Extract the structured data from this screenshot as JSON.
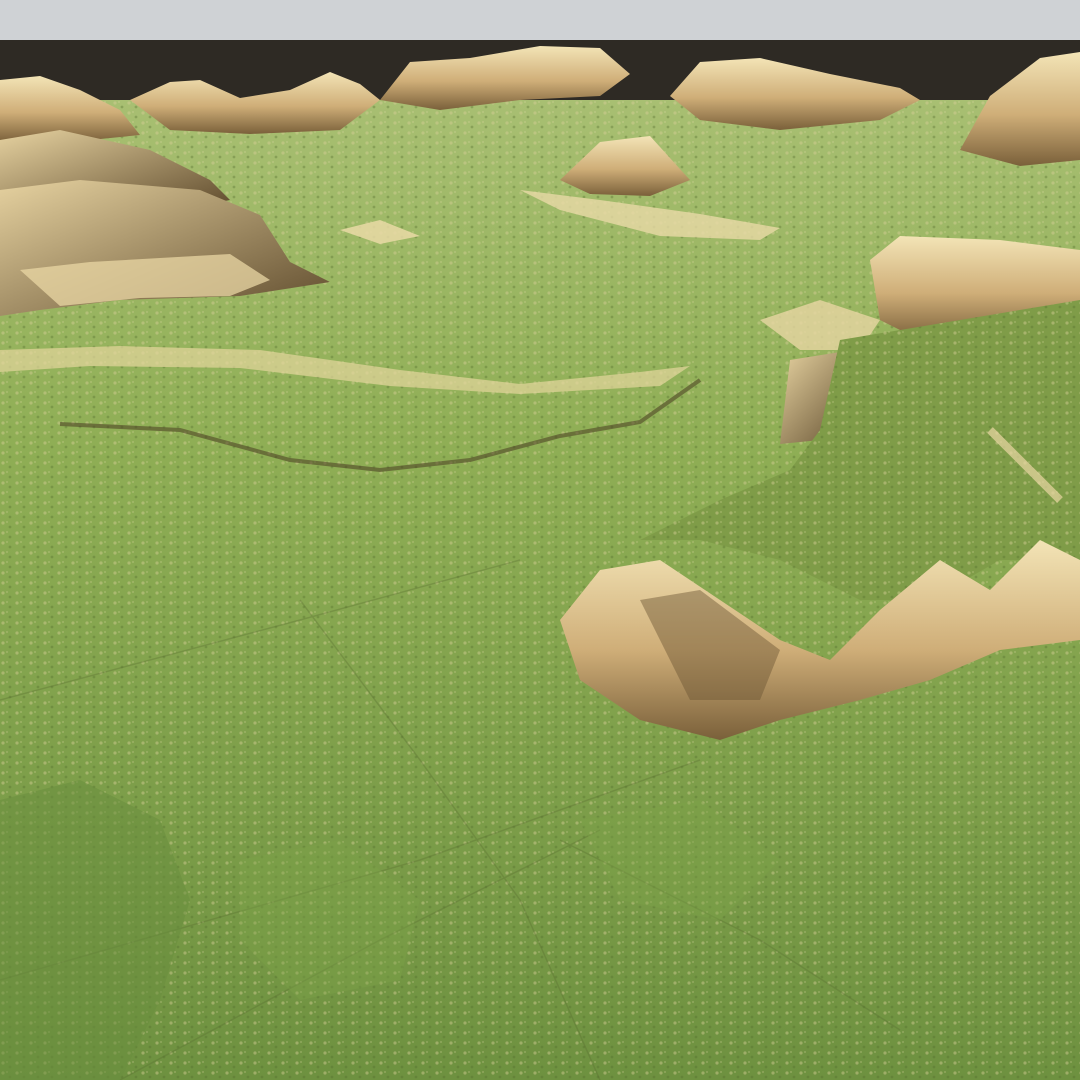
{
  "scene": {
    "kind": "3d-terrain-render",
    "colors": {
      "sky": "#cfd2d5",
      "horizon_band": "#2e2a24",
      "grass_light": "#9ab862",
      "grass_mid": "#7fa04a",
      "grass_dark": "#5f7d34",
      "rock_light": "#f2e2b0",
      "rock_mid": "#c8a874",
      "rock_shadow": "#6b5432",
      "ridge_line": "#4a3c22"
    }
  }
}
